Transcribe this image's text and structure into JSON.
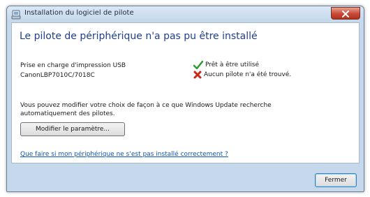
{
  "window": {
    "title": "Installation du logiciel de pilote",
    "close_tooltip_icon": "close-icon"
  },
  "main": {
    "heading": "Le pilote de périphérique n'a pas pu être installé",
    "device": {
      "type": "Prise en charge d'impression USB",
      "model": "CanonLBP7010C/7018C"
    },
    "status": {
      "ok_text": "Prêt à être utilisé",
      "error_text": "Aucun pilote n'a été trouvé."
    },
    "info_text": "Vous pouvez modifier votre choix de façon à ce que Windows Update recherche automatiquement des pilotes.",
    "modify_button_label": "Modifier le paramètre...",
    "help_link": "Que faire si mon périphérique ne s'est pas installé correctement ?"
  },
  "footer": {
    "close_button_label": "Fermer"
  },
  "colors": {
    "heading": "#1f3e8d",
    "link": "#0b55b7",
    "ok": "#2f9a2f",
    "error": "#c9271a"
  }
}
